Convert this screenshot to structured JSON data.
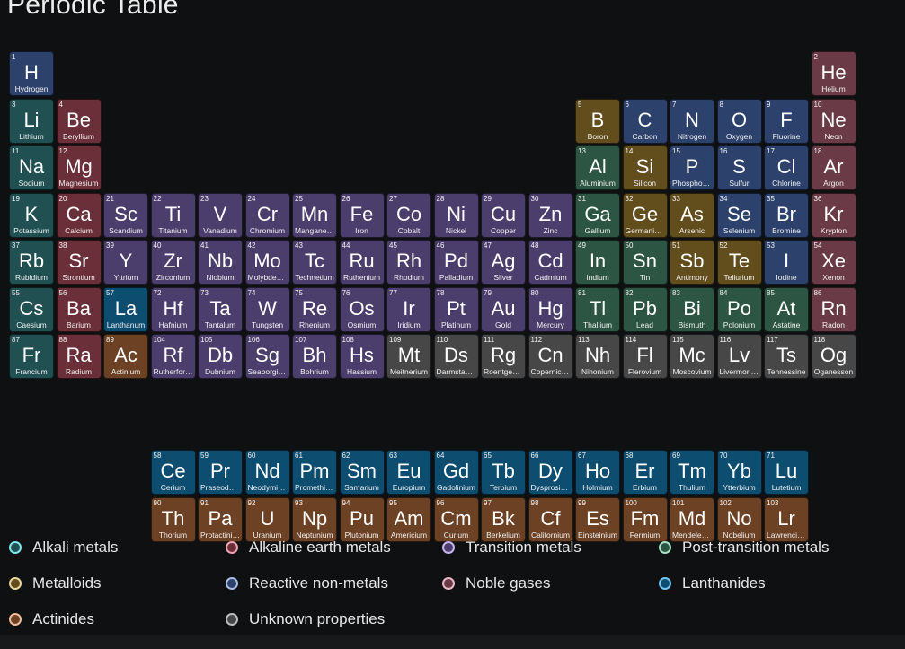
{
  "title": "Periodic Table",
  "category_styles": {
    "alkali": {
      "bg": "#205052",
      "dot": "#7fe6ec"
    },
    "alkaline": {
      "bg": "#6b2f39",
      "dot": "#f0a3b0"
    },
    "transition": {
      "bg": "#4c3e6c",
      "dot": "#c6b5f0"
    },
    "post": {
      "bg": "#2d5544",
      "dot": "#a8e0c4"
    },
    "metalloid": {
      "bg": "#624d1d",
      "dot": "#ead59b"
    },
    "nonmetal": {
      "bg": "#2c416b",
      "dot": "#a9bde6"
    },
    "noble": {
      "bg": "#6a3b47",
      "dot": "#e9b7c4"
    },
    "lanthanide": {
      "bg": "#0c4d70",
      "dot": "#72c4ee"
    },
    "actinide": {
      "bg": "#6c4124",
      "dot": "#efbb9a"
    },
    "unknown": {
      "bg": "#474747",
      "dot": "#bcbcbc"
    }
  },
  "elements": [
    {
      "n": "1",
      "sym": "H",
      "name": "Hydrogen",
      "cat": "nonmetal",
      "r": 1,
      "c": 1
    },
    {
      "n": "2",
      "sym": "He",
      "name": "Helium",
      "cat": "noble",
      "r": 1,
      "c": 18
    },
    {
      "n": "3",
      "sym": "Li",
      "name": "Lithium",
      "cat": "alkali",
      "r": 2,
      "c": 1
    },
    {
      "n": "4",
      "sym": "Be",
      "name": "Beryllium",
      "cat": "alkaline",
      "r": 2,
      "c": 2
    },
    {
      "n": "5",
      "sym": "B",
      "name": "Boron",
      "cat": "metalloid",
      "r": 2,
      "c": 13
    },
    {
      "n": "6",
      "sym": "C",
      "name": "Carbon",
      "cat": "nonmetal",
      "r": 2,
      "c": 14
    },
    {
      "n": "7",
      "sym": "N",
      "name": "Nitrogen",
      "cat": "nonmetal",
      "r": 2,
      "c": 15
    },
    {
      "n": "8",
      "sym": "O",
      "name": "Oxygen",
      "cat": "nonmetal",
      "r": 2,
      "c": 16
    },
    {
      "n": "9",
      "sym": "F",
      "name": "Fluorine",
      "cat": "nonmetal",
      "r": 2,
      "c": 17
    },
    {
      "n": "10",
      "sym": "Ne",
      "name": "Neon",
      "cat": "noble",
      "r": 2,
      "c": 18
    },
    {
      "n": "11",
      "sym": "Na",
      "name": "Sodium",
      "cat": "alkali",
      "r": 3,
      "c": 1
    },
    {
      "n": "12",
      "sym": "Mg",
      "name": "Magnesium",
      "cat": "alkaline",
      "r": 3,
      "c": 2
    },
    {
      "n": "13",
      "sym": "Al",
      "name": "Aluminium",
      "cat": "post",
      "r": 3,
      "c": 13
    },
    {
      "n": "14",
      "sym": "Si",
      "name": "Silicon",
      "cat": "metalloid",
      "r": 3,
      "c": 14
    },
    {
      "n": "15",
      "sym": "P",
      "name": "Phosphorus",
      "cat": "nonmetal",
      "r": 3,
      "c": 15
    },
    {
      "n": "16",
      "sym": "S",
      "name": "Sulfur",
      "cat": "nonmetal",
      "r": 3,
      "c": 16
    },
    {
      "n": "17",
      "sym": "Cl",
      "name": "Chlorine",
      "cat": "nonmetal",
      "r": 3,
      "c": 17
    },
    {
      "n": "18",
      "sym": "Ar",
      "name": "Argon",
      "cat": "noble",
      "r": 3,
      "c": 18
    },
    {
      "n": "19",
      "sym": "K",
      "name": "Potassium",
      "cat": "alkali",
      "r": 4,
      "c": 1
    },
    {
      "n": "20",
      "sym": "Ca",
      "name": "Calcium",
      "cat": "alkaline",
      "r": 4,
      "c": 2
    },
    {
      "n": "21",
      "sym": "Sc",
      "name": "Scandium",
      "cat": "transition",
      "r": 4,
      "c": 3
    },
    {
      "n": "22",
      "sym": "Ti",
      "name": "Titanium",
      "cat": "transition",
      "r": 4,
      "c": 4
    },
    {
      "n": "23",
      "sym": "V",
      "name": "Vanadium",
      "cat": "transition",
      "r": 4,
      "c": 5
    },
    {
      "n": "24",
      "sym": "Cr",
      "name": "Chromium",
      "cat": "transition",
      "r": 4,
      "c": 6
    },
    {
      "n": "25",
      "sym": "Mn",
      "name": "Manganese",
      "cat": "transition",
      "r": 4,
      "c": 7
    },
    {
      "n": "26",
      "sym": "Fe",
      "name": "Iron",
      "cat": "transition",
      "r": 4,
      "c": 8
    },
    {
      "n": "27",
      "sym": "Co",
      "name": "Cobalt",
      "cat": "transition",
      "r": 4,
      "c": 9
    },
    {
      "n": "28",
      "sym": "Ni",
      "name": "Nickel",
      "cat": "transition",
      "r": 4,
      "c": 10
    },
    {
      "n": "29",
      "sym": "Cu",
      "name": "Copper",
      "cat": "transition",
      "r": 4,
      "c": 11
    },
    {
      "n": "30",
      "sym": "Zn",
      "name": "Zinc",
      "cat": "transition",
      "r": 4,
      "c": 12
    },
    {
      "n": "31",
      "sym": "Ga",
      "name": "Gallium",
      "cat": "post",
      "r": 4,
      "c": 13
    },
    {
      "n": "32",
      "sym": "Ge",
      "name": "Germanium",
      "cat": "metalloid",
      "r": 4,
      "c": 14
    },
    {
      "n": "33",
      "sym": "As",
      "name": "Arsenic",
      "cat": "metalloid",
      "r": 4,
      "c": 15
    },
    {
      "n": "34",
      "sym": "Se",
      "name": "Selenium",
      "cat": "nonmetal",
      "r": 4,
      "c": 16
    },
    {
      "n": "35",
      "sym": "Br",
      "name": "Bromine",
      "cat": "nonmetal",
      "r": 4,
      "c": 17
    },
    {
      "n": "36",
      "sym": "Kr",
      "name": "Krypton",
      "cat": "noble",
      "r": 4,
      "c": 18
    },
    {
      "n": "37",
      "sym": "Rb",
      "name": "Rubidium",
      "cat": "alkali",
      "r": 5,
      "c": 1
    },
    {
      "n": "38",
      "sym": "Sr",
      "name": "Strontium",
      "cat": "alkaline",
      "r": 5,
      "c": 2
    },
    {
      "n": "39",
      "sym": "Y",
      "name": "Yttrium",
      "cat": "transition",
      "r": 5,
      "c": 3
    },
    {
      "n": "40",
      "sym": "Zr",
      "name": "Zirconium",
      "cat": "transition",
      "r": 5,
      "c": 4
    },
    {
      "n": "41",
      "sym": "Nb",
      "name": "Niobium",
      "cat": "transition",
      "r": 5,
      "c": 5
    },
    {
      "n": "42",
      "sym": "Mo",
      "name": "Molybdenum",
      "cat": "transition",
      "r": 5,
      "c": 6
    },
    {
      "n": "43",
      "sym": "Tc",
      "name": "Technetium",
      "cat": "transition",
      "r": 5,
      "c": 7
    },
    {
      "n": "44",
      "sym": "Ru",
      "name": "Ruthenium",
      "cat": "transition",
      "r": 5,
      "c": 8
    },
    {
      "n": "45",
      "sym": "Rh",
      "name": "Rhodium",
      "cat": "transition",
      "r": 5,
      "c": 9
    },
    {
      "n": "46",
      "sym": "Pd",
      "name": "Palladium",
      "cat": "transition",
      "r": 5,
      "c": 10
    },
    {
      "n": "47",
      "sym": "Ag",
      "name": "Silver",
      "cat": "transition",
      "r": 5,
      "c": 11
    },
    {
      "n": "48",
      "sym": "Cd",
      "name": "Cadmium",
      "cat": "transition",
      "r": 5,
      "c": 12
    },
    {
      "n": "49",
      "sym": "In",
      "name": "Indium",
      "cat": "post",
      "r": 5,
      "c": 13
    },
    {
      "n": "50",
      "sym": "Sn",
      "name": "Tin",
      "cat": "post",
      "r": 5,
      "c": 14
    },
    {
      "n": "51",
      "sym": "Sb",
      "name": "Antimony",
      "cat": "metalloid",
      "r": 5,
      "c": 15
    },
    {
      "n": "52",
      "sym": "Te",
      "name": "Tellurium",
      "cat": "metalloid",
      "r": 5,
      "c": 16
    },
    {
      "n": "53",
      "sym": "I",
      "name": "Iodine",
      "cat": "nonmetal",
      "r": 5,
      "c": 17
    },
    {
      "n": "54",
      "sym": "Xe",
      "name": "Xenon",
      "cat": "noble",
      "r": 5,
      "c": 18
    },
    {
      "n": "55",
      "sym": "Cs",
      "name": "Caesium",
      "cat": "alkali",
      "r": 6,
      "c": 1
    },
    {
      "n": "56",
      "sym": "Ba",
      "name": "Barium",
      "cat": "alkaline",
      "r": 6,
      "c": 2
    },
    {
      "n": "57",
      "sym": "La",
      "name": "Lanthanum",
      "cat": "lanthanide",
      "r": 6,
      "c": 3
    },
    {
      "n": "72",
      "sym": "Hf",
      "name": "Hafnium",
      "cat": "transition",
      "r": 6,
      "c": 4
    },
    {
      "n": "73",
      "sym": "Ta",
      "name": "Tantalum",
      "cat": "transition",
      "r": 6,
      "c": 5
    },
    {
      "n": "74",
      "sym": "W",
      "name": "Tungsten",
      "cat": "transition",
      "r": 6,
      "c": 6
    },
    {
      "n": "75",
      "sym": "Re",
      "name": "Rhenium",
      "cat": "transition",
      "r": 6,
      "c": 7
    },
    {
      "n": "76",
      "sym": "Os",
      "name": "Osmium",
      "cat": "transition",
      "r": 6,
      "c": 8
    },
    {
      "n": "77",
      "sym": "Ir",
      "name": "Iridium",
      "cat": "transition",
      "r": 6,
      "c": 9
    },
    {
      "n": "78",
      "sym": "Pt",
      "name": "Platinum",
      "cat": "transition",
      "r": 6,
      "c": 10
    },
    {
      "n": "79",
      "sym": "Au",
      "name": "Gold",
      "cat": "transition",
      "r": 6,
      "c": 11
    },
    {
      "n": "80",
      "sym": "Hg",
      "name": "Mercury",
      "cat": "transition",
      "r": 6,
      "c": 12
    },
    {
      "n": "81",
      "sym": "Tl",
      "name": "Thallium",
      "cat": "post",
      "r": 6,
      "c": 13
    },
    {
      "n": "82",
      "sym": "Pb",
      "name": "Lead",
      "cat": "post",
      "r": 6,
      "c": 14
    },
    {
      "n": "83",
      "sym": "Bi",
      "name": "Bismuth",
      "cat": "post",
      "r": 6,
      "c": 15
    },
    {
      "n": "84",
      "sym": "Po",
      "name": "Polonium",
      "cat": "post",
      "r": 6,
      "c": 16
    },
    {
      "n": "85",
      "sym": "At",
      "name": "Astatine",
      "cat": "post",
      "r": 6,
      "c": 17
    },
    {
      "n": "86",
      "sym": "Rn",
      "name": "Radon",
      "cat": "noble",
      "r": 6,
      "c": 18
    },
    {
      "n": "87",
      "sym": "Fr",
      "name": "Francium",
      "cat": "alkali",
      "r": 7,
      "c": 1
    },
    {
      "n": "88",
      "sym": "Ra",
      "name": "Radium",
      "cat": "alkaline",
      "r": 7,
      "c": 2
    },
    {
      "n": "89",
      "sym": "Ac",
      "name": "Actinium",
      "cat": "actinide",
      "r": 7,
      "c": 3
    },
    {
      "n": "104",
      "sym": "Rf",
      "name": "Rutherfordium",
      "cat": "transition",
      "r": 7,
      "c": 4
    },
    {
      "n": "105",
      "sym": "Db",
      "name": "Dubnium",
      "cat": "transition",
      "r": 7,
      "c": 5
    },
    {
      "n": "106",
      "sym": "Sg",
      "name": "Seaborgium",
      "cat": "transition",
      "r": 7,
      "c": 6
    },
    {
      "n": "107",
      "sym": "Bh",
      "name": "Bohrium",
      "cat": "transition",
      "r": 7,
      "c": 7
    },
    {
      "n": "108",
      "sym": "Hs",
      "name": "Hassium",
      "cat": "transition",
      "r": 7,
      "c": 8
    },
    {
      "n": "109",
      "sym": "Mt",
      "name": "Meitnerium",
      "cat": "unknown",
      "r": 7,
      "c": 9
    },
    {
      "n": "110",
      "sym": "Ds",
      "name": "Darmstadtium",
      "cat": "unknown",
      "r": 7,
      "c": 10
    },
    {
      "n": "111",
      "sym": "Rg",
      "name": "Roentgenium",
      "cat": "unknown",
      "r": 7,
      "c": 11
    },
    {
      "n": "112",
      "sym": "Cn",
      "name": "Copernicium",
      "cat": "unknown",
      "r": 7,
      "c": 12
    },
    {
      "n": "113",
      "sym": "Nh",
      "name": "Nihonium",
      "cat": "unknown",
      "r": 7,
      "c": 13
    },
    {
      "n": "114",
      "sym": "Fl",
      "name": "Flerovium",
      "cat": "unknown",
      "r": 7,
      "c": 14
    },
    {
      "n": "115",
      "sym": "Mc",
      "name": "Moscovium",
      "cat": "unknown",
      "r": 7,
      "c": 15
    },
    {
      "n": "116",
      "sym": "Lv",
      "name": "Livermorium",
      "cat": "unknown",
      "r": 7,
      "c": 16
    },
    {
      "n": "117",
      "sym": "Ts",
      "name": "Tennessine",
      "cat": "unknown",
      "r": 7,
      "c": 17
    },
    {
      "n": "118",
      "sym": "Og",
      "name": "Oganesson",
      "cat": "unknown",
      "r": 7,
      "c": 18
    },
    {
      "n": "58",
      "sym": "Ce",
      "name": "Cerium",
      "cat": "lanthanide",
      "r": 9,
      "c": 4
    },
    {
      "n": "59",
      "sym": "Pr",
      "name": "Praseodymium",
      "cat": "lanthanide",
      "r": 9,
      "c": 5
    },
    {
      "n": "60",
      "sym": "Nd",
      "name": "Neodymium",
      "cat": "lanthanide",
      "r": 9,
      "c": 6
    },
    {
      "n": "61",
      "sym": "Pm",
      "name": "Promethium",
      "cat": "lanthanide",
      "r": 9,
      "c": 7
    },
    {
      "n": "62",
      "sym": "Sm",
      "name": "Samarium",
      "cat": "lanthanide",
      "r": 9,
      "c": 8
    },
    {
      "n": "63",
      "sym": "Eu",
      "name": "Europium",
      "cat": "lanthanide",
      "r": 9,
      "c": 9
    },
    {
      "n": "64",
      "sym": "Gd",
      "name": "Gadolinium",
      "cat": "lanthanide",
      "r": 9,
      "c": 10
    },
    {
      "n": "65",
      "sym": "Tb",
      "name": "Terbium",
      "cat": "lanthanide",
      "r": 9,
      "c": 11
    },
    {
      "n": "66",
      "sym": "Dy",
      "name": "Dysprosium",
      "cat": "lanthanide",
      "r": 9,
      "c": 12
    },
    {
      "n": "67",
      "sym": "Ho",
      "name": "Holmium",
      "cat": "lanthanide",
      "r": 9,
      "c": 13
    },
    {
      "n": "68",
      "sym": "Er",
      "name": "Erbium",
      "cat": "lanthanide",
      "r": 9,
      "c": 14
    },
    {
      "n": "69",
      "sym": "Tm",
      "name": "Thulium",
      "cat": "lanthanide",
      "r": 9,
      "c": 15
    },
    {
      "n": "70",
      "sym": "Yb",
      "name": "Ytterbium",
      "cat": "lanthanide",
      "r": 9,
      "c": 16
    },
    {
      "n": "71",
      "sym": "Lu",
      "name": "Lutetium",
      "cat": "lanthanide",
      "r": 9,
      "c": 17
    },
    {
      "n": "90",
      "sym": "Th",
      "name": "Thorium",
      "cat": "actinide",
      "r": 10,
      "c": 4
    },
    {
      "n": "91",
      "sym": "Pa",
      "name": "Protactinium",
      "cat": "actinide",
      "r": 10,
      "c": 5
    },
    {
      "n": "92",
      "sym": "U",
      "name": "Uranium",
      "cat": "actinide",
      "r": 10,
      "c": 6
    },
    {
      "n": "93",
      "sym": "Np",
      "name": "Neptunium",
      "cat": "actinide",
      "r": 10,
      "c": 7
    },
    {
      "n": "94",
      "sym": "Pu",
      "name": "Plutonium",
      "cat": "actinide",
      "r": 10,
      "c": 8
    },
    {
      "n": "95",
      "sym": "Am",
      "name": "Americium",
      "cat": "actinide",
      "r": 10,
      "c": 9
    },
    {
      "n": "96",
      "sym": "Cm",
      "name": "Curium",
      "cat": "actinide",
      "r": 10,
      "c": 10
    },
    {
      "n": "97",
      "sym": "Bk",
      "name": "Berkelium",
      "cat": "actinide",
      "r": 10,
      "c": 11
    },
    {
      "n": "98",
      "sym": "Cf",
      "name": "Californium",
      "cat": "actinide",
      "r": 10,
      "c": 12
    },
    {
      "n": "99",
      "sym": "Es",
      "name": "Einsteinium",
      "cat": "actinide",
      "r": 10,
      "c": 13
    },
    {
      "n": "100",
      "sym": "Fm",
      "name": "Fermium",
      "cat": "actinide",
      "r": 10,
      "c": 14
    },
    {
      "n": "101",
      "sym": "Md",
      "name": "Mendelevium",
      "cat": "actinide",
      "r": 10,
      "c": 15
    },
    {
      "n": "102",
      "sym": "No",
      "name": "Nobelium",
      "cat": "actinide",
      "r": 10,
      "c": 16
    },
    {
      "n": "103",
      "sym": "Lr",
      "name": "Lawrencium",
      "cat": "actinide",
      "r": 10,
      "c": 17
    }
  ],
  "legend": [
    {
      "label": "Alkali metals",
      "cat": "alkali"
    },
    {
      "label": "Alkaline earth metals",
      "cat": "alkaline"
    },
    {
      "label": "Transition metals",
      "cat": "transition"
    },
    {
      "label": "Post-transition metals",
      "cat": "post"
    },
    {
      "label": "Metalloids",
      "cat": "metalloid"
    },
    {
      "label": "Reactive non-metals",
      "cat": "nonmetal"
    },
    {
      "label": "Noble gases",
      "cat": "noble"
    },
    {
      "label": "Lanthanides",
      "cat": "lanthanide"
    },
    {
      "label": "Actinides",
      "cat": "actinide"
    },
    {
      "label": "Unknown properties",
      "cat": "unknown"
    }
  ]
}
